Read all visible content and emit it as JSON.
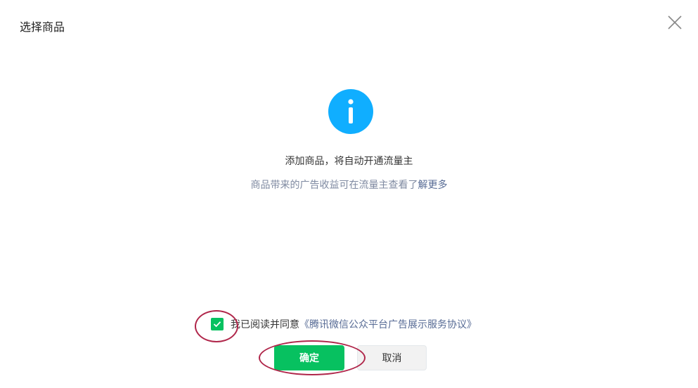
{
  "dialog": {
    "title": "选择商品",
    "close_icon": "close-icon"
  },
  "content": {
    "icon": "info-icon",
    "icon_color": "#10aeff",
    "icon_glyph": "i",
    "message": "添加商品，将自动开通流量主",
    "sub_message_prefix": "商品带来的广告收益可在流量主查看了",
    "learn_more": "解更多"
  },
  "agreement": {
    "checked": true,
    "text": "我已阅读并同意",
    "link": "《腾讯微信公众平台广告展示服务协议》"
  },
  "actions": {
    "confirm": "确定",
    "cancel": "取消"
  },
  "colors": {
    "primary": "#07c160",
    "link": "#576b95",
    "annotation": "#b0264a"
  }
}
